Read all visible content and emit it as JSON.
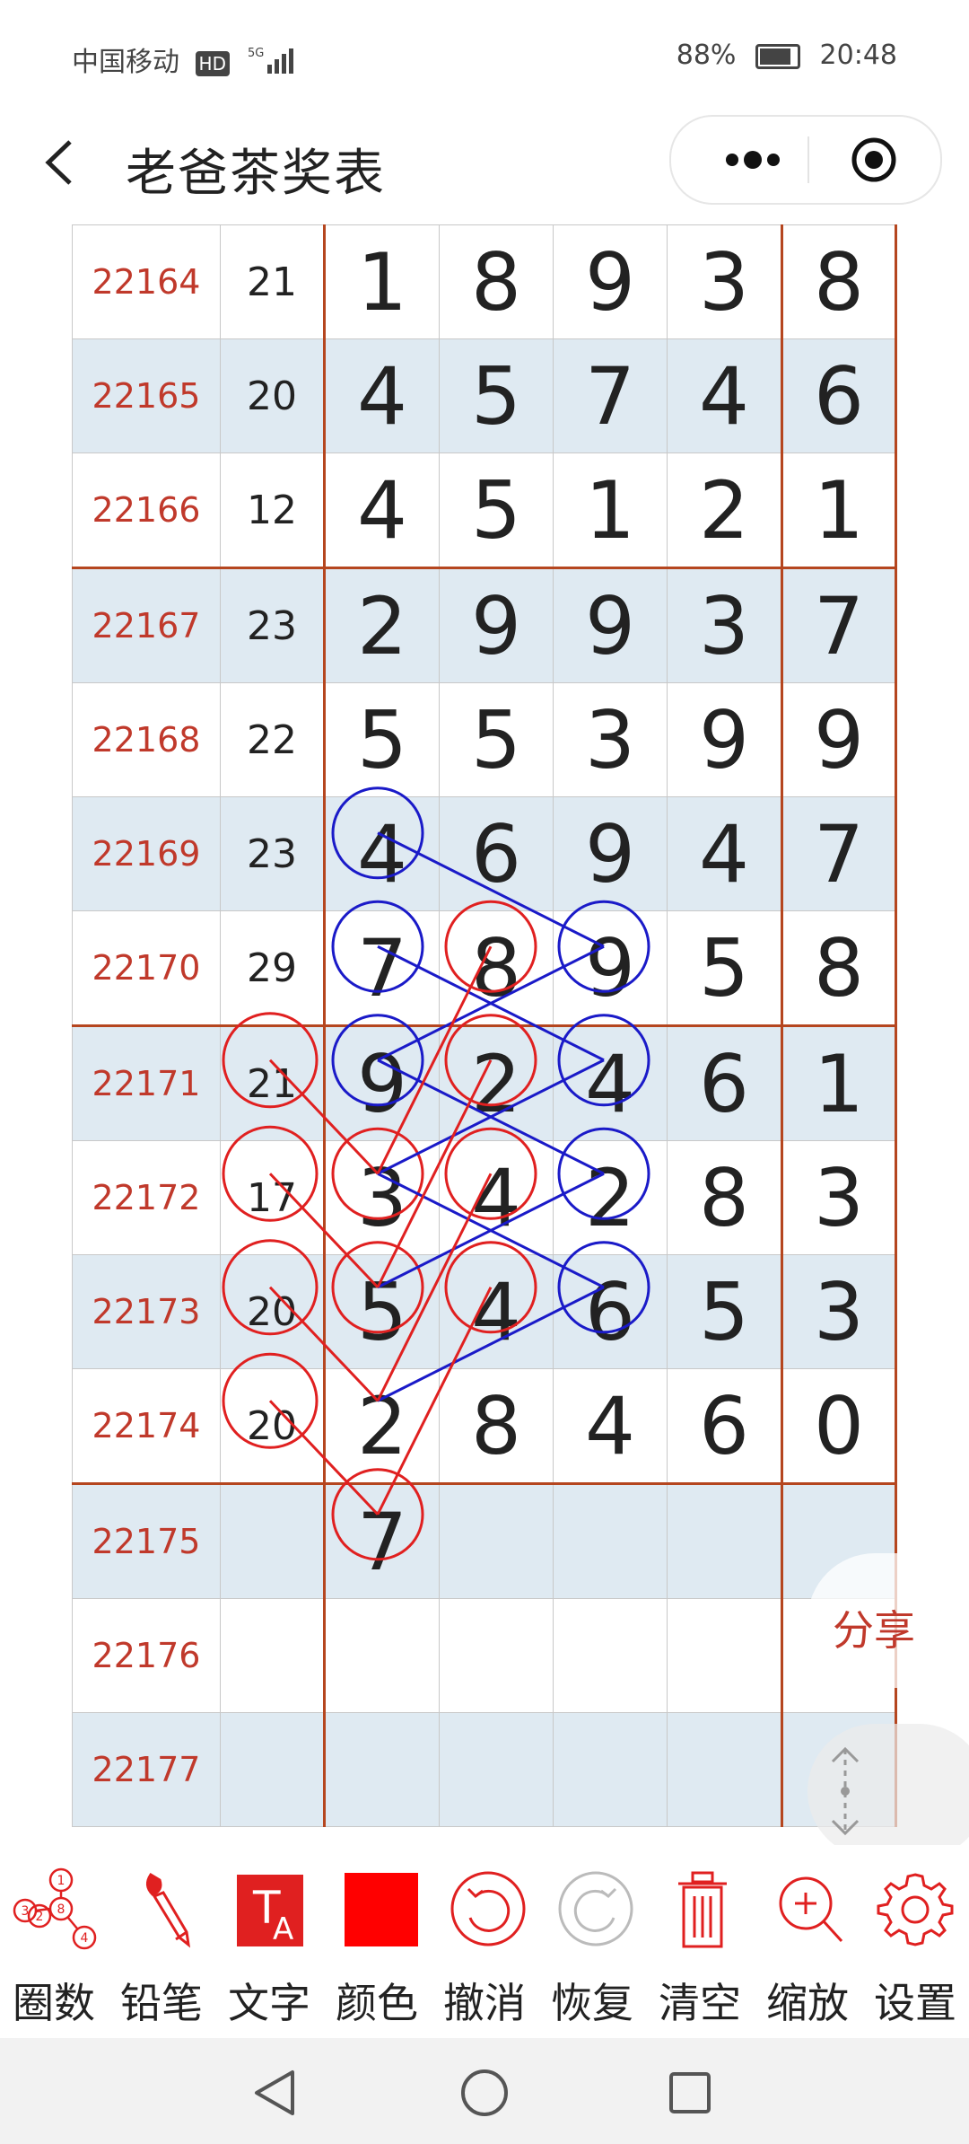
{
  "status": {
    "carrier": "中国移动",
    "hd": "HD",
    "network": "5G",
    "battery": "88%",
    "time": "20:48"
  },
  "header": {
    "title": "老爸茶奖表"
  },
  "table": {
    "rows": [
      {
        "period": "22164",
        "sum": "21",
        "digits": [
          "1",
          "8",
          "9",
          "3",
          "8"
        ]
      },
      {
        "period": "22165",
        "sum": "20",
        "digits": [
          "4",
          "5",
          "7",
          "4",
          "6"
        ]
      },
      {
        "period": "22166",
        "sum": "12",
        "digits": [
          "4",
          "5",
          "1",
          "2",
          "1"
        ]
      },
      {
        "period": "22167",
        "sum": "23",
        "digits": [
          "2",
          "9",
          "9",
          "3",
          "7"
        ]
      },
      {
        "period": "22168",
        "sum": "22",
        "digits": [
          "5",
          "5",
          "3",
          "9",
          "9"
        ]
      },
      {
        "period": "22169",
        "sum": "23",
        "digits": [
          "4",
          "6",
          "9",
          "4",
          "7"
        ]
      },
      {
        "period": "22170",
        "sum": "29",
        "digits": [
          "7",
          "8",
          "9",
          "5",
          "8"
        ]
      },
      {
        "period": "22171",
        "sum": "21",
        "digits": [
          "9",
          "2",
          "4",
          "6",
          "1"
        ]
      },
      {
        "period": "22172",
        "sum": "17",
        "digits": [
          "3",
          "4",
          "2",
          "8",
          "3"
        ]
      },
      {
        "period": "22173",
        "sum": "20",
        "digits": [
          "5",
          "4",
          "6",
          "5",
          "3"
        ]
      },
      {
        "period": "22174",
        "sum": "20",
        "digits": [
          "2",
          "8",
          "4",
          "6",
          "0"
        ]
      },
      {
        "period": "22175",
        "sum": "",
        "digits": [
          "7",
          "",
          "",
          "",
          ""
        ]
      },
      {
        "period": "22176",
        "sum": "",
        "digits": [
          "",
          "",
          "",
          "",
          ""
        ]
      },
      {
        "period": "22177",
        "sum": "",
        "digits": [
          "",
          "",
          "",
          "",
          ""
        ]
      }
    ]
  },
  "floating": {
    "share_label": "分享"
  },
  "toolbar": {
    "items": [
      {
        "label": "圈数",
        "icon": "circle-numbers-icon"
      },
      {
        "label": "铅笔",
        "icon": "pencil-icon"
      },
      {
        "label": "文字",
        "icon": "text-icon"
      },
      {
        "label": "颜色",
        "icon": "color-swatch-icon"
      },
      {
        "label": "撤消",
        "icon": "undo-icon"
      },
      {
        "label": "恢复",
        "icon": "redo-icon"
      },
      {
        "label": "清空",
        "icon": "trash-icon"
      },
      {
        "label": "缩放",
        "icon": "zoom-in-icon"
      },
      {
        "label": "设置",
        "icon": "gear-icon"
      }
    ],
    "mini_digits": [
      "1",
      "3",
      "8",
      "2",
      "4"
    ],
    "text_icon_letters": [
      "T",
      "A"
    ]
  },
  "colors": {
    "accent_red": "#e02020",
    "mark_red": "#e02020",
    "mark_blue": "#1a1ac8",
    "grid_border": "#b5461f",
    "period_text": "#c0392b",
    "row_alt": "#dfeaf2"
  }
}
